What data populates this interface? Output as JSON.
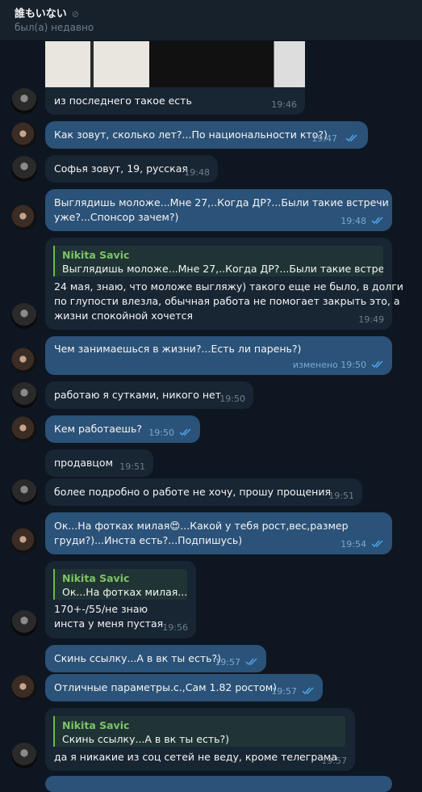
{
  "header": {
    "title": "誰もいない",
    "mute_icon": "⊘",
    "status": "был(а) недавно"
  },
  "messages": [
    {
      "text": "из последнего такое есть",
      "time": "19:46"
    },
    {
      "text": "Как зовут, сколько лет?...По национальности кто?)",
      "time": "19:47"
    },
    {
      "text": "Софья зовут, 19, русская",
      "time": "19:48"
    },
    {
      "text_l1": "Выглядишь моложе...Мне 27,..Когда ДР?...Были такие встречи",
      "text_l2": "уже?...Спонсор зачем?)",
      "time": "19:48"
    },
    {
      "reply_name": "Nikita Savic",
      "reply_text": "Выглядишь моложе...Мне 27,..Когда ДР?...Были такие встреч...",
      "text_l1": "24 мая, знаю, что моложе выгляжу) такого еще не было, в долги",
      "text_l2": "по глупости влезла, обычная работа не помогает закрыть это, а",
      "text_l3": "жизни спокойной хочется",
      "time": "19:49"
    },
    {
      "text": "Чем занимаешься в жизни?...Есть ли парень?)",
      "edited": "изменено",
      "time": "19:50"
    },
    {
      "text": "работаю я сутками, никого нет",
      "time": "19:50"
    },
    {
      "text": "Кем работаешь?",
      "time": "19:50"
    },
    {
      "text": "продавцом",
      "time": "19:51"
    },
    {
      "text": "более подробно о работе не хочу, прошу прощения",
      "time": "19:51"
    },
    {
      "text_l1a": "Ок...На фотках милая",
      "emoji": "😍",
      "text_l1b": "...Какой у тебя рост,вес,размер",
      "text_l2": "груди?)...Инста есть?...Подпишусь)",
      "time": "19:54"
    },
    {
      "reply_name": "Nikita Savic",
      "reply_text": "Ок...На фотках милая...",
      "text_l1": "170+-/55/не знаю",
      "text_l2": "инста у меня пустая",
      "time": "19:56"
    },
    {
      "text": "Скинь ссылку...А в вк ты есть?)",
      "time": "19:57"
    },
    {
      "text": "Отличные параметры.с.,Сам 1.82 ростом)",
      "time": "19:57"
    },
    {
      "reply_name": "Nikita Savic",
      "reply_text": "Скинь ссылку...А в вк ты есть?)",
      "text": "да я никакие из соц сетей не веду, кроме телеграма",
      "time": "19:57"
    }
  ],
  "colors": {
    "background": "#0e1621",
    "incoming_bubble": "#182533",
    "outgoing_bubble": "#2b5278",
    "reply_accent": "#6ab84a",
    "check_color": "#4fa3e8"
  }
}
